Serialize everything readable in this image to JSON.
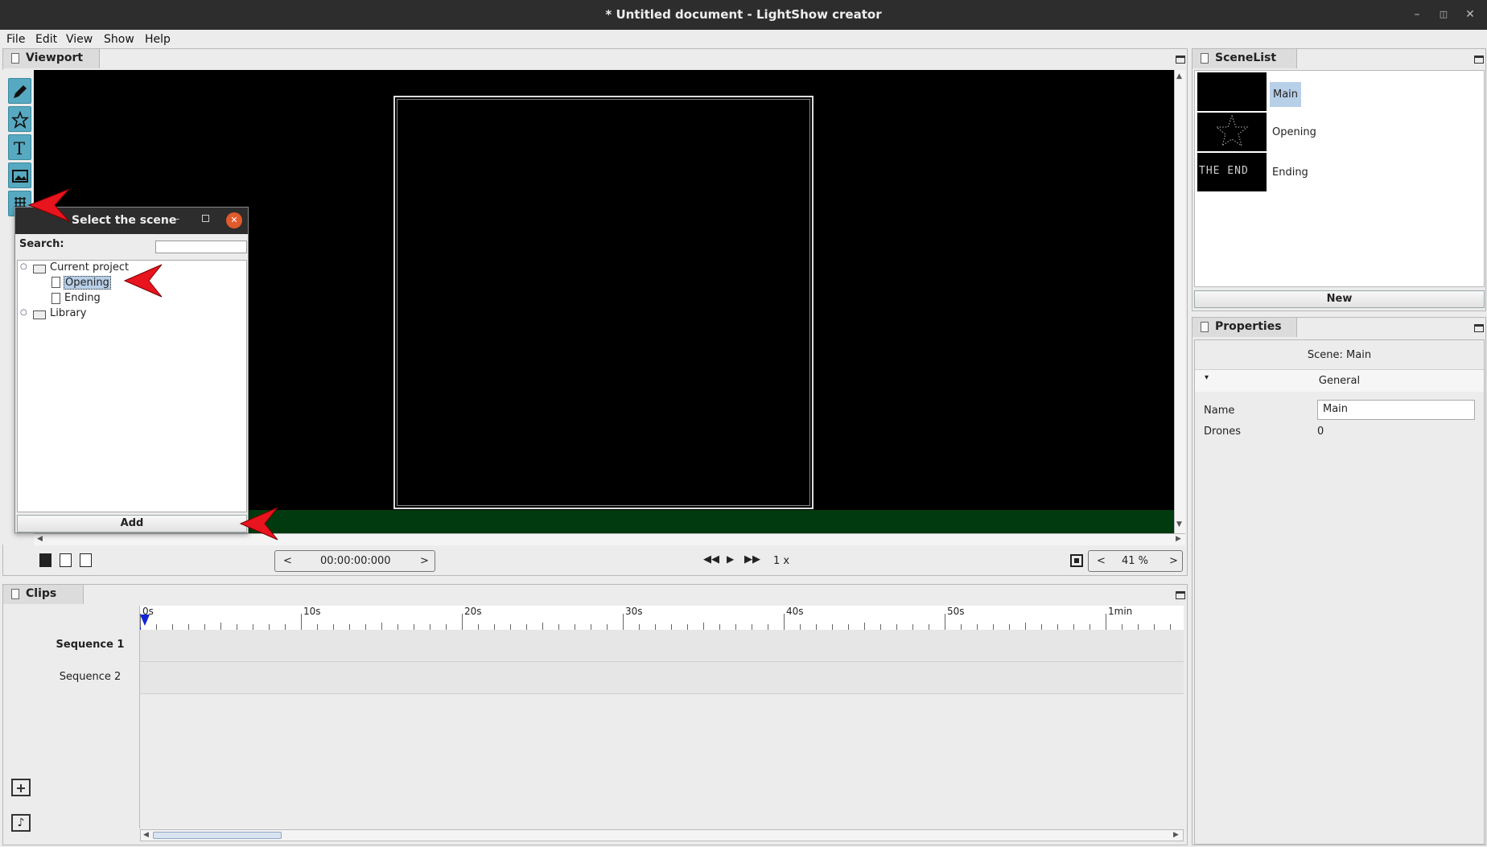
{
  "window": {
    "title": "* Untitled document - LightShow creator",
    "controls": [
      "minimize",
      "restore",
      "close"
    ]
  },
  "menu": [
    "File",
    "Edit",
    "View",
    "Show",
    "Help"
  ],
  "viewport": {
    "tab_label": "Viewport",
    "tools": [
      "pencil-icon",
      "star-icon",
      "text-icon",
      "image-icon",
      "grid-icon"
    ],
    "time": {
      "prev": "<",
      "value": "00:00:00:000",
      "next": ">"
    },
    "speed": "1 x",
    "zoom": {
      "prev": "<",
      "value": "41 %",
      "next": ">"
    }
  },
  "dialog": {
    "title": "Select the scene",
    "search_label": "Search:",
    "search_value": "",
    "tree": {
      "root": "Current project",
      "children": [
        "Opening",
        "Ending"
      ],
      "library": "Library",
      "selected": "Opening"
    },
    "add_label": "Add"
  },
  "clips": {
    "tab_label": "Clips",
    "ruler": [
      "0s",
      "10s",
      "20s",
      "30s",
      "40s",
      "50s",
      "1min"
    ],
    "sequences": [
      "Sequence 1",
      "Sequence 2"
    ],
    "active_sequence": "Sequence 1"
  },
  "scenelist": {
    "tab_label": "SceneList",
    "scenes": [
      {
        "name": "Main",
        "thumb": "blank"
      },
      {
        "name": "Opening",
        "thumb": "star"
      },
      {
        "name": "Ending",
        "thumb": "THE END"
      }
    ],
    "selected": "Main",
    "new_label": "New"
  },
  "properties": {
    "tab_label": "Properties",
    "header": "Scene: Main",
    "section": "General",
    "fields": [
      {
        "label": "Name",
        "value": "Main"
      },
      {
        "label": "Drones",
        "value": "0"
      }
    ]
  },
  "colors": {
    "accent_tool": "#56a9c0",
    "selection": "#b8cfe8",
    "title_bar": "#2d2d2d",
    "annotation_arrow": "#e8141e"
  }
}
